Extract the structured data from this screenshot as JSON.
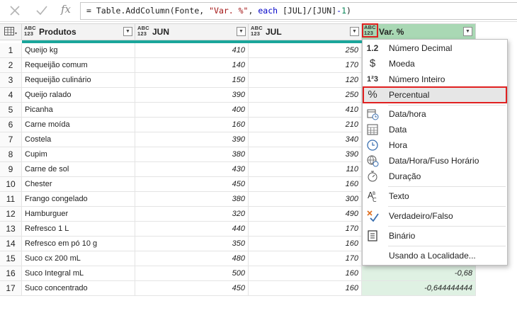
{
  "formula": {
    "prefix": "= Table.AddColumn(Fonte, ",
    "string": "\"Var. %\"",
    "middle": ", ",
    "keyword": "each",
    "expr": " [JUL]/[JUN]",
    "minus": "-",
    "num": "1",
    "close": ")"
  },
  "columns": [
    {
      "type_line1": "ABC",
      "type_line2": "123",
      "label": "Produtos",
      "dropdown": "▼"
    },
    {
      "type_line1": "ABC",
      "type_line2": "123",
      "label": "JUN",
      "dropdown": "▼"
    },
    {
      "type_line1": "ABC",
      "type_line2": "123",
      "label": "JUL",
      "dropdown": "▼"
    },
    {
      "type_line1": "ABC",
      "type_line2": "123",
      "label": "Var. %",
      "dropdown": "▼"
    }
  ],
  "rows": [
    {
      "idx": "1",
      "produto": "Queijo kg",
      "jun": "410",
      "jul": "250",
      "var": ""
    },
    {
      "idx": "2",
      "produto": "Requeijão comum",
      "jun": "140",
      "jul": "170",
      "var": ""
    },
    {
      "idx": "3",
      "produto": "Requeijão culinário",
      "jun": "150",
      "jul": "120",
      "var": ""
    },
    {
      "idx": "4",
      "produto": "Queijo ralado",
      "jun": "390",
      "jul": "250",
      "var": ""
    },
    {
      "idx": "5",
      "produto": "Picanha",
      "jun": "400",
      "jul": "410",
      "var": ""
    },
    {
      "idx": "6",
      "produto": "Carne moída",
      "jun": "160",
      "jul": "210",
      "var": ""
    },
    {
      "idx": "7",
      "produto": "Costela",
      "jun": "390",
      "jul": "340",
      "var": ""
    },
    {
      "idx": "8",
      "produto": "Cupim",
      "jun": "380",
      "jul": "390",
      "var": ""
    },
    {
      "idx": "9",
      "produto": "Carne de sol",
      "jun": "430",
      "jul": "110",
      "var": ""
    },
    {
      "idx": "10",
      "produto": "Chester",
      "jun": "450",
      "jul": "160",
      "var": ""
    },
    {
      "idx": "11",
      "produto": "Frango congelado",
      "jun": "380",
      "jul": "300",
      "var": ""
    },
    {
      "idx": "12",
      "produto": "Hamburguer",
      "jun": "320",
      "jul": "490",
      "var": ""
    },
    {
      "idx": "13",
      "produto": "Refresco 1 L",
      "jun": "440",
      "jul": "170",
      "var": ""
    },
    {
      "idx": "14",
      "produto": "Refresco em pó 10 g",
      "jun": "350",
      "jul": "160",
      "var": ""
    },
    {
      "idx": "15",
      "produto": "Suco cx 200 mL",
      "jun": "480",
      "jul": "170",
      "var": ""
    },
    {
      "idx": "16",
      "produto": "Suco Integral mL",
      "jun": "500",
      "jul": "160",
      "var": "-0,68"
    },
    {
      "idx": "17",
      "produto": "Suco concentrado",
      "jun": "450",
      "jul": "160",
      "var": "-0,644444444"
    }
  ],
  "menu": [
    {
      "icon": "1.2",
      "label": "Número Decimal"
    },
    {
      "icon": "$",
      "label": "Moeda"
    },
    {
      "icon": "1²3",
      "label": "Número Inteiro"
    },
    {
      "icon": "%",
      "label": "Percentual"
    },
    {
      "icon": "",
      "label": "Data/hora"
    },
    {
      "icon": "",
      "label": "Data"
    },
    {
      "icon": "",
      "label": "Hora"
    },
    {
      "icon": "",
      "label": "Data/Hora/Fuso Horário"
    },
    {
      "icon": "",
      "label": "Duração"
    },
    {
      "icon": "A",
      "label": "Texto"
    },
    {
      "icon": "",
      "label": "Verdadeiro/Falso"
    },
    {
      "icon": "",
      "label": "Binário"
    },
    {
      "icon": "",
      "label": "Usando a Localidade..."
    }
  ],
  "colors": {
    "accent_teal": "#1aa69b",
    "selected_header": "#a9d8b4",
    "selected_cells": "#dff1e3",
    "highlight_red": "#e02020"
  }
}
